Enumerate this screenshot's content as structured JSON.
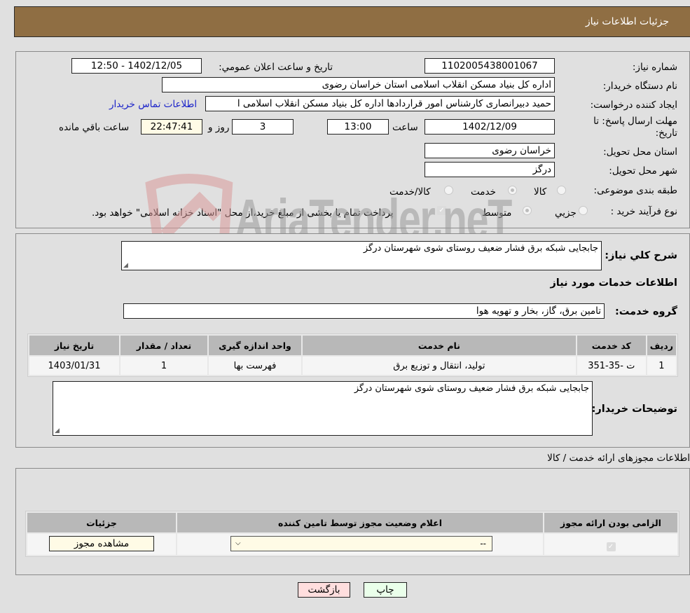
{
  "header": {
    "title": "جزئیات اطلاعات نیاز"
  },
  "form": {
    "need_number": {
      "label": "شماره نیاز:",
      "value": "1102005438001067"
    },
    "announce_datetime": {
      "label": "تاریخ و ساعت اعلان عمومي:",
      "value": "1402/12/05 - 12:50"
    },
    "buyer_org": {
      "label": "نام دستگاه خریدار:",
      "value": "اداره کل بنیاد مسکن انقلاب اسلامی استان خراسان رضوی"
    },
    "requester": {
      "label": "ایجاد کننده درخواست:",
      "value": "حمید دبیرانصاری کارشناس امور قراردادها اداره کل بنیاد مسکن انقلاب اسلامی ا",
      "contact_link": "اطلاعات تماس خریدار"
    },
    "deadline": {
      "label": "مهلت ارسال پاسخ: تا تاریخ:",
      "date": "1402/12/09",
      "time_label": "ساعت",
      "time": "13:00",
      "days": "3",
      "days_label": "روز و",
      "remaining": "22:47:41",
      "remaining_label": "ساعت باقي مانده"
    },
    "province": {
      "label": "استان محل تحویل:",
      "value": "خراسان رضوی"
    },
    "city": {
      "label": "شهر محل تحویل:",
      "value": "درگز"
    },
    "category": {
      "label": "طبقه بندی موضوعی:",
      "options": [
        {
          "label": "کالا",
          "selected": false
        },
        {
          "label": "خدمت",
          "selected": true
        },
        {
          "label": "کالا/خدمت",
          "selected": false
        }
      ]
    },
    "process_type": {
      "label": "نوع فرآیند خرید :",
      "options": [
        {
          "label": "جزيي",
          "selected": false
        },
        {
          "label": "متوسط",
          "selected": true
        }
      ],
      "treasury_checkbox_label": "پرداخت تمام یا بخشی از مبلغ خرید،از محل \"اسناد خزانه اسلامی\" خواهد بود.",
      "treasury_checked": true
    }
  },
  "description": {
    "label": "شرح کلي نیاز:",
    "value": "جابجایی شبکه برق فشار ضعیف روستای شوی شهرستان درگز"
  },
  "services": {
    "title": "اطلاعات خدمات مورد نیاز",
    "group_label": "گروه خدمت:",
    "group_value": "تامین برق، گاز، بخار و تهویه هوا",
    "table": {
      "headers": [
        "ردیف",
        "کد خدمت",
        "نام خدمت",
        "واحد اندازه گیری",
        "تعداد / مقدار",
        "تاریخ نیاز"
      ],
      "rows": [
        [
          "1",
          "ت -35-351",
          "تولید، انتقال و توزیع برق",
          "فهرست بها",
          "1",
          "1403/01/31"
        ]
      ]
    },
    "buyer_notes_label": "توضیحات خریدار:",
    "buyer_notes_value": "جابجایی شبکه برق فشار ضعیف روستای شوی شهرستان درگز"
  },
  "permits": {
    "title": "اطلاعات مجوزهای ارائه خدمت / کالا",
    "table": {
      "headers": [
        "الزامی بودن ارائه مجوز",
        "اعلام وضعیت مجوز توسط تامین کننده",
        "جزئیات"
      ],
      "rows": [
        {
          "required_checked": true,
          "status_value": "--",
          "details_button": "مشاهده مجوز"
        }
      ]
    }
  },
  "buttons": {
    "print": "چاپ",
    "back": "بازگشت"
  },
  "watermark": {
    "text": "AriaTender.neT"
  },
  "colors": {
    "header_bg": "#8f6e43",
    "back_btn_bg": "#ffdede",
    "print_btn_bg": "#eaffea",
    "link": "#1a22c9"
  }
}
